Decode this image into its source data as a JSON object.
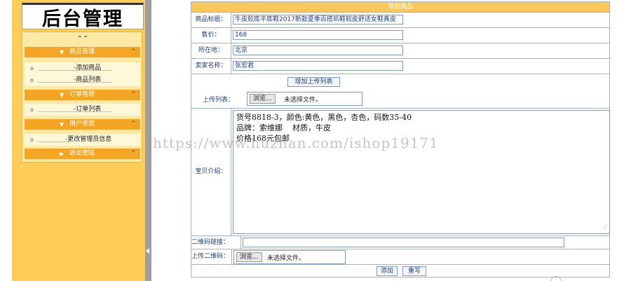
{
  "sidebar": {
    "logo": "后台管理",
    "collapse_all": "⌃⌃",
    "groups": [
      {
        "title": "商品管理",
        "items": [
          "-添加商品",
          "-商品列表"
        ]
      },
      {
        "title": "订单管理",
        "items": [
          "-订单列表"
        ]
      },
      {
        "title": "用户管理",
        "items": [
          "-更改管理员信息"
        ]
      },
      {
        "title": "退出登陆",
        "items": []
      }
    ],
    "expanded_arrow": "▼",
    "collapsed_arrow": "▶",
    "group_chevron": "⌃"
  },
  "form": {
    "panel_title": "添加商品",
    "title_label": "商品标题：",
    "title_value": "牛皮软底平底鞋2017新款夏季百搭凯鞋软皮舒适女鞋真皮",
    "price_label": "售价：",
    "price_value": "168",
    "location_label": "所在地：",
    "location_value": "北京",
    "seller_label": "卖家名称：",
    "seller_value": "张宏君",
    "add_upload_list_button": "增加上传列表",
    "upload_list_label": "上传列表：",
    "browse_label": "浏览...",
    "no_file_selected": "未选择文件。",
    "description_label": "宝贝介绍：",
    "description_lines": [
      "货号8818-3，颜色:黄色，黑色，杏色，码数35-40",
      "品牌：索维娜    材质，牛皮",
      "",
      "价格168元包邮"
    ],
    "qr_link_label": "二维码链接：",
    "qr_link_value": "",
    "qr_upload_label": "上传二维码：",
    "submit_button": "添加",
    "reset_button": "重写"
  },
  "watermark": "https://www.huzhan.com/ishop19171",
  "colors": {
    "sidebar_bg": "#fecd57",
    "group_header": "#f5a524",
    "panel_title_bg": "#fac85a",
    "label_text": "#20407a",
    "border": "#9fb3cc"
  }
}
